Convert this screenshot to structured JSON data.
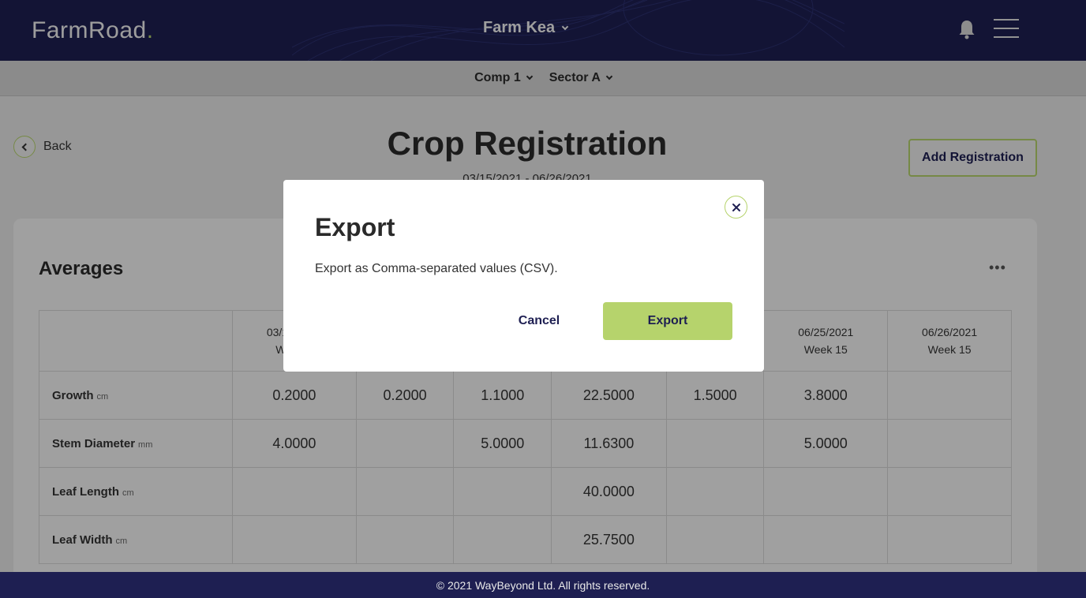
{
  "brand": {
    "logo_text": "FarmRoad",
    "logo_dot": "."
  },
  "header": {
    "farm_name": "Farm Kea"
  },
  "subnav": {
    "compartment": "Comp 1",
    "sector": "Sector A"
  },
  "page": {
    "back_label": "Back",
    "title": "Crop Registration",
    "date_range": "03/15/2021 - 06/26/2021",
    "add_button": "Add Registration"
  },
  "card": {
    "title": "Averages",
    "more_label": "•••",
    "columns": [
      {
        "date": "03/15/2021",
        "week": "Week 1"
      },
      {
        "date": "",
        "week": ""
      },
      {
        "date": "",
        "week": ""
      },
      {
        "date": "",
        "week": ""
      },
      {
        "date": "",
        "week": ""
      },
      {
        "date": "06/25/2021",
        "week": "Week 15"
      },
      {
        "date": "06/26/2021",
        "week": "Week 15"
      }
    ],
    "rows": [
      {
        "label": "Growth",
        "unit": "cm",
        "values": [
          "0.2000",
          "0.2000",
          "1.1000",
          "22.5000",
          "1.5000",
          "3.8000",
          ""
        ]
      },
      {
        "label": "Stem Diameter",
        "unit": "mm",
        "values": [
          "4.0000",
          "",
          "5.0000",
          "11.6300",
          "",
          "5.0000",
          ""
        ]
      },
      {
        "label": "Leaf Length",
        "unit": "cm",
        "values": [
          "",
          "",
          "",
          "40.0000",
          "",
          "",
          ""
        ]
      },
      {
        "label": "Leaf Width",
        "unit": "cm",
        "values": [
          "",
          "",
          "",
          "25.7500",
          "",
          "",
          ""
        ]
      }
    ]
  },
  "modal": {
    "title": "Export",
    "message": "Export as Comma-separated values (CSV).",
    "cancel_label": "Cancel",
    "export_label": "Export"
  },
  "footer": {
    "text": "© 2021 WayBeyond Ltd. All rights reserved."
  },
  "colors": {
    "navy": "#1e1f52",
    "accent_green": "#b6d36c"
  }
}
